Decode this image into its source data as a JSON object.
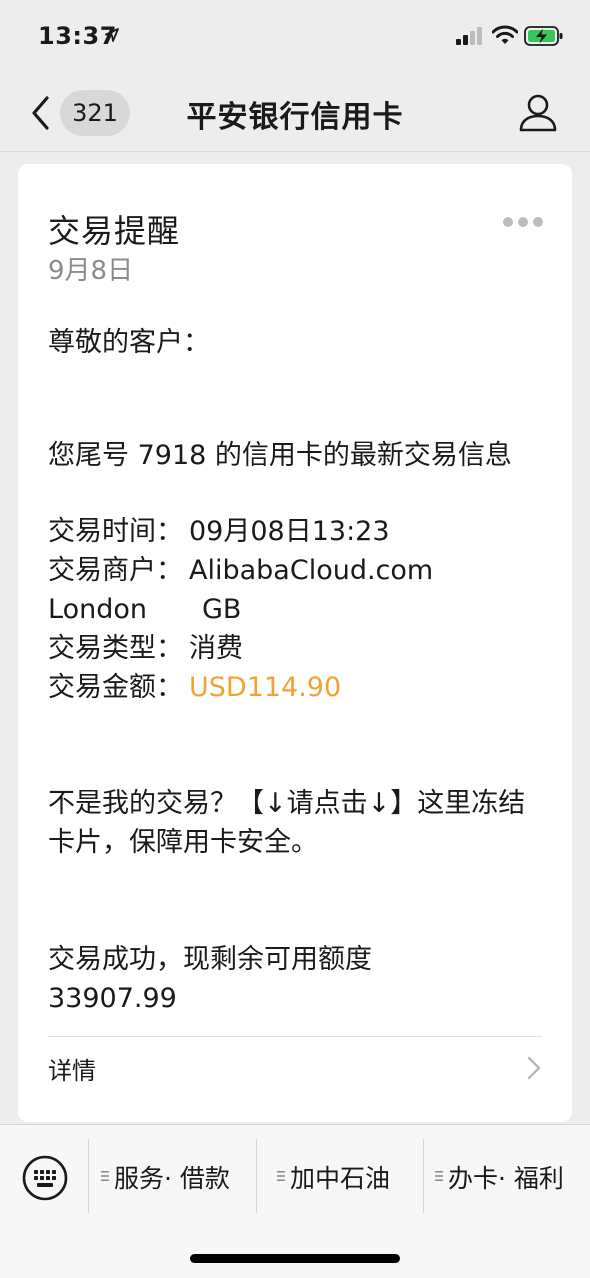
{
  "status_bar": {
    "time": "13:37"
  },
  "nav": {
    "badge": "321",
    "title": "平安银行信用卡"
  },
  "card": {
    "title": "交易提醒",
    "date": "9月8日",
    "greeting": "尊敬的客户：",
    "intro": "您尾号 7918 的信用卡的最新交易信息",
    "rows": [
      {
        "label": "交易时间：",
        "value": "09月08日13:23"
      },
      {
        "label": "交易商户：",
        "value": "AlibabaCloud.com"
      },
      {
        "label": "交易类型：",
        "value": "消费"
      },
      {
        "label": "交易金额：",
        "value": "USD114.90"
      }
    ],
    "location_city": "London",
    "location_country": "GB",
    "warning": "不是我的交易？【↓请点击↓】这里冻结卡片，保障用卡安全。",
    "success_line1": "交易成功，现剩余可用额度",
    "success_line2": "33907.99",
    "details_label": "详情",
    "amount_color": "#f0a232"
  },
  "bottom_menu": {
    "items": [
      {
        "label": "服务· 借款"
      },
      {
        "label": "加中石油"
      },
      {
        "label": "办卡· 福利"
      }
    ]
  },
  "icons": [
    "location-arrow-icon",
    "signal-icon",
    "wifi-icon",
    "battery-charging-icon",
    "back-chevron-icon",
    "profile-icon",
    "more-dots-icon",
    "chevron-right-icon",
    "keyboard-icon",
    "menu-lines-icon"
  ]
}
